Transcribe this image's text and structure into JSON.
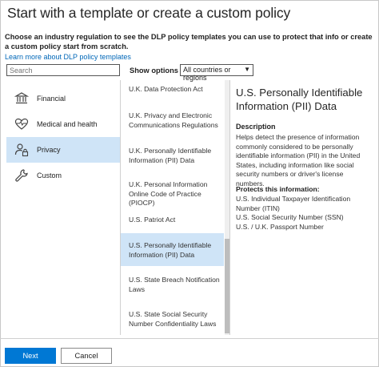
{
  "page": {
    "title": "Start with a template or create a custom policy",
    "description": "Choose an industry regulation to see the DLP policy templates you can use to protect that info or create a custom policy start from scratch.",
    "learn_more": "Learn more about DLP policy templates"
  },
  "search": {
    "placeholder": "Search"
  },
  "filter": {
    "label": "Show options for",
    "selected": "All countries or regions"
  },
  "categories": [
    {
      "label": "Financial",
      "icon": "bank-icon",
      "selected": false
    },
    {
      "label": "Medical and health",
      "icon": "heart-icon",
      "selected": false
    },
    {
      "label": "Privacy",
      "icon": "person-lock-icon",
      "selected": true
    },
    {
      "label": "Custom",
      "icon": "wrench-icon",
      "selected": false
    }
  ],
  "templates": [
    {
      "label": "U.K. Data Protection Act",
      "selected": false
    },
    {
      "label": "U.K. Privacy and Electronic Communications Regulations",
      "selected": false
    },
    {
      "label": "U.K. Personally Identifiable Information (PII) Data",
      "selected": false
    },
    {
      "label": "U.K. Personal Information Online Code of Practice (PIOCP)",
      "selected": false
    },
    {
      "label": "U.S. Patriot Act",
      "selected": false
    },
    {
      "label": "U.S. Personally Identifiable Information (PII) Data",
      "selected": true
    },
    {
      "label": "U.S. State Breach Notification Laws",
      "selected": false
    },
    {
      "label": "U.S. State Social Security Number Confidentiality Laws",
      "selected": false
    }
  ],
  "detail": {
    "title": "U.S. Personally Identifiable Information (PII) Data",
    "description_heading": "Description",
    "description": "Helps detect the presence of information commonly considered to be personally identifiable information (PII) in the United States, including information like social security numbers or driver's license numbers.",
    "protects_heading": "Protects this information:",
    "protects": [
      "U.S. Individual Taxpayer Identification Number (ITIN)",
      "U.S. Social Security Number (SSN)",
      "U.S. / U.K. Passport Number"
    ]
  },
  "footer": {
    "next": "Next",
    "cancel": "Cancel"
  },
  "colors": {
    "accent": "#0078d4",
    "selected_bg": "#cfe4f7",
    "link": "#0067b8"
  }
}
